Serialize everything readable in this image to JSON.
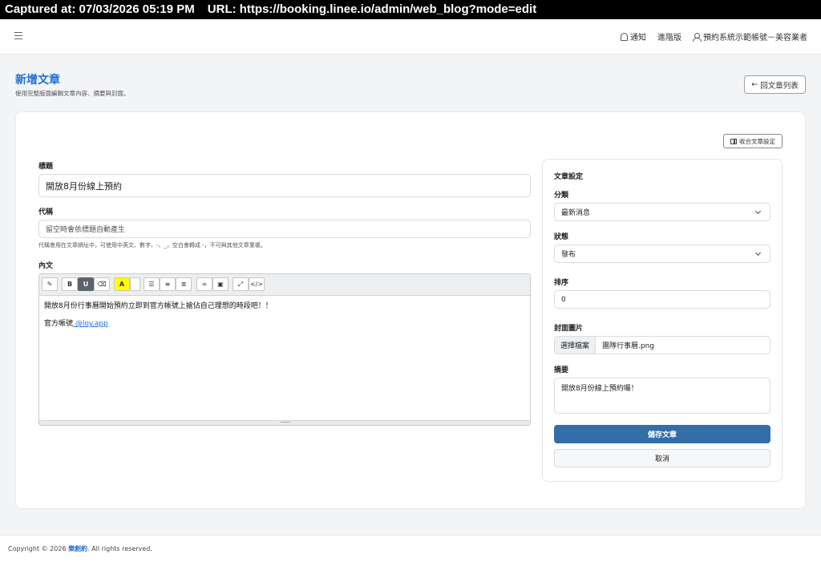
{
  "capture": {
    "captured_label": "Captured at: 07/03/2026 05:19 PM",
    "url_label": "URL: https://booking.linee.io/admin/web_blog?mode=edit"
  },
  "topnav": {
    "notify": "通知",
    "advanced": "進階版",
    "account": "預約系統示範帳號－美容業者"
  },
  "header": {
    "title": "新增文章",
    "subtitle": "使用完整版面編輯文章內容、摘要與封面。",
    "back_label": "回文章列表"
  },
  "collapse_label": "收合文章設定",
  "form": {
    "title_label": "標題",
    "title_value": "開放8月份線上預約",
    "slug_label": "代稱",
    "slug_placeholder": "留空時會依標題自動產生",
    "slug_hint": "代稱會用在文章網址中，可使用中英文、數字、-、_，空白會轉成 -，不可與其他文章重複。",
    "content_label": "內文"
  },
  "editor": {
    "toolbar": [
      "magic-icon",
      "bold-icon",
      "underline-icon",
      "eraser-icon",
      "font-color-icon",
      "unordered-list-icon",
      "ordered-list-icon",
      "align-icon",
      "link-icon",
      "image-icon",
      "fullscreen-icon",
      "code-view-icon"
    ],
    "line1": "開放8月份行事曆開始預約立即到官方帳號上搶佔自己理想的時段吧！！",
    "line2_prefix": "官方帳號",
    "line2_link": " @loy.app"
  },
  "settings": {
    "heading": "文章設定",
    "category_label": "分類",
    "category_value": "最新消息",
    "status_label": "狀態",
    "status_value": "發布",
    "order_label": "排序",
    "order_value": "0",
    "cover_label": "封面圖片",
    "file_button": "選擇檔案",
    "file_name": "團隊行事曆.png",
    "summary_label": "摘要",
    "summary_value": "開放8月份線上預約囉！",
    "save_label": "儲存文章",
    "cancel_label": "取消"
  },
  "footer": {
    "prefix": "Copyright © 2026 ",
    "brand": "樂創約",
    "suffix": ". All rights reserved."
  },
  "colors": {
    "accent": "#1f6fd6",
    "save_button": "#336ea8"
  }
}
